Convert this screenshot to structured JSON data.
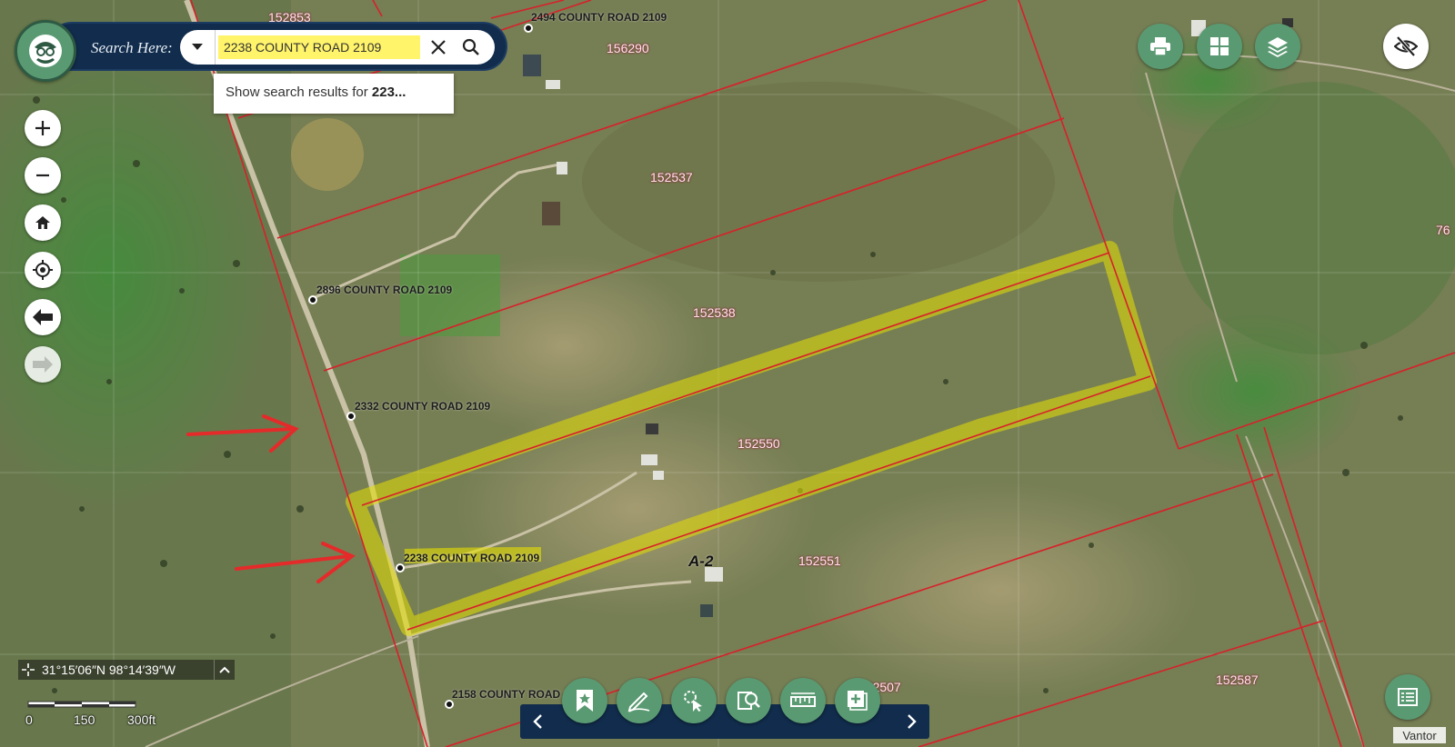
{
  "search": {
    "label": "Search Here:",
    "value": "2238 COUNTY ROAD 2109",
    "suggestion_prefix": "Show search results for ",
    "suggestion_bold": "223...",
    "dropdown_icon": "caret-down-icon",
    "clear_icon": "close-icon",
    "go_icon": "search-icon"
  },
  "map_controls": [
    {
      "name": "zoom-in-button",
      "icon": "plus-icon",
      "glyph": "+"
    },
    {
      "name": "zoom-out-button",
      "icon": "minus-icon",
      "glyph": "−"
    },
    {
      "name": "home-button",
      "icon": "home-icon"
    },
    {
      "name": "locate-button",
      "icon": "crosshair-icon"
    },
    {
      "name": "back-button",
      "icon": "arrow-left-icon"
    },
    {
      "name": "forward-button",
      "icon": "arrow-right-icon",
      "disabled": true
    }
  ],
  "top_right": [
    {
      "name": "print-button",
      "icon": "printer-icon"
    },
    {
      "name": "basemap-button",
      "icon": "grid-icon"
    },
    {
      "name": "layers-button",
      "icon": "layers-icon"
    },
    {
      "name": "hide-ui-button",
      "icon": "eye-slash-icon"
    }
  ],
  "parcels": [
    "152853",
    "156290",
    "152537",
    "152538",
    "152550",
    "152551",
    "152507",
    "152587",
    "76"
  ],
  "addresses": [
    "2494 COUNTY ROAD 2109",
    "2896 COUNTY ROAD 2109",
    "2332 COUNTY ROAD 2109",
    "2238 COUNTY ROAD 2109",
    "2158 COUNTY ROAD 2109"
  ],
  "zone_label": "A-2",
  "coordinates": "31°15′06″N 98°14′39″W",
  "scale": {
    "labels": [
      "0",
      "150",
      "300ft"
    ]
  },
  "toolbar": {
    "tools": [
      {
        "name": "bookmark-tool-button",
        "icon": "bookmark-star-icon"
      },
      {
        "name": "draw-tool-button",
        "icon": "pencil-icon"
      },
      {
        "name": "select-tool-button",
        "icon": "select-cursor-icon"
      },
      {
        "name": "query-tool-button",
        "icon": "document-search-icon"
      },
      {
        "name": "measure-tool-button",
        "icon": "ruler-icon"
      },
      {
        "name": "add-data-tool-button",
        "icon": "add-layer-icon"
      }
    ],
    "prev_icon": "chevron-left-icon",
    "next_icon": "chevron-right-icon"
  },
  "legend_icon": "legend-list-icon",
  "attribution": "Vantor",
  "colors": {
    "parcel_line": "#d8202a",
    "highlight": "#e6e000",
    "annotation_arrow": "#e52a2a",
    "panel_navy": "#112c4c",
    "button_green": "#5a9a72"
  }
}
